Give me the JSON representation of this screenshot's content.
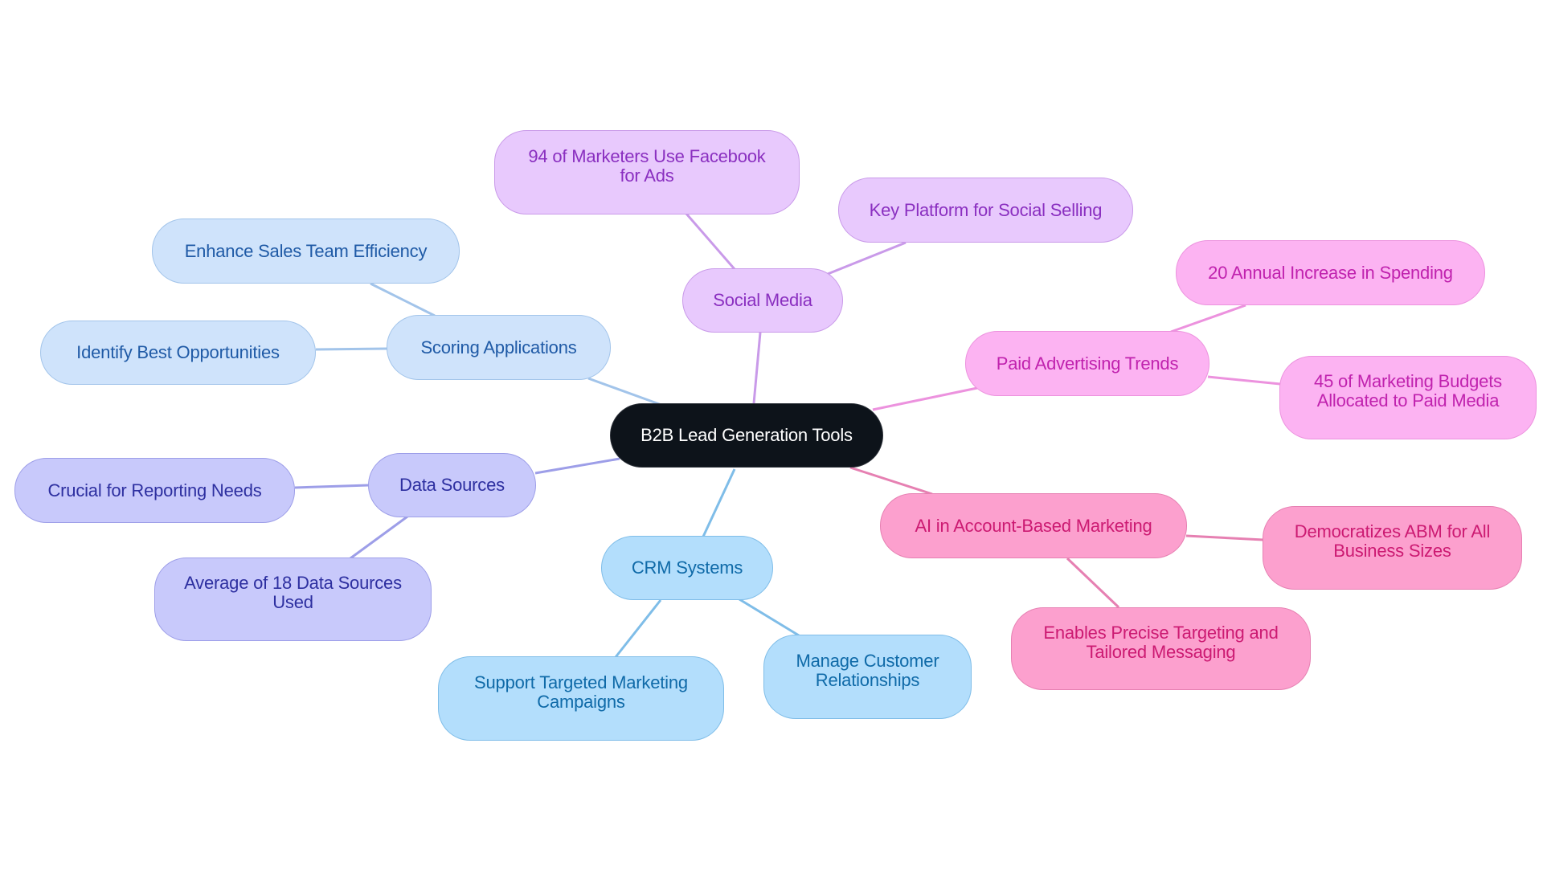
{
  "diagram": {
    "type": "mind-map",
    "root": {
      "id": "root",
      "label": "B2B Lead Generation Tools"
    },
    "branches": [
      {
        "id": "scoring",
        "label": "Scoring Applications",
        "color": "#a2c4ea",
        "children": [
          {
            "id": "scoring-1",
            "label": "Enhance Sales Team Efficiency"
          },
          {
            "id": "scoring-2",
            "label": "Identify Best Opportunities"
          }
        ]
      },
      {
        "id": "data",
        "label": "Data Sources",
        "color": "#9d9ee8",
        "children": [
          {
            "id": "data-1",
            "label": "Crucial for Reporting Needs"
          },
          {
            "id": "data-2",
            "label": "Average of 18 Data Sources Used"
          }
        ]
      },
      {
        "id": "crm",
        "label": "CRM Systems",
        "color": "#7fbde8",
        "children": [
          {
            "id": "crm-1",
            "label": "Support Targeted Marketing Campaigns"
          },
          {
            "id": "crm-2",
            "label": "Manage Customer Relationships"
          }
        ]
      },
      {
        "id": "social",
        "label": "Social Media",
        "color": "#c99ae9",
        "children": [
          {
            "id": "social-1",
            "label": "94 of Marketers Use Facebook for Ads"
          },
          {
            "id": "social-2",
            "label": "Key Platform for Social Selling"
          }
        ]
      },
      {
        "id": "paid",
        "label": "Paid Advertising Trends",
        "color": "#ec92de",
        "children": [
          {
            "id": "paid-1",
            "label": "20 Annual Increase in Spending"
          },
          {
            "id": "paid-2",
            "label": "45 of Marketing Budgets Allocated to Paid Media"
          }
        ]
      },
      {
        "id": "abm",
        "label": "AI in Account-Based Marketing",
        "color": "#e680b2",
        "children": [
          {
            "id": "abm-1",
            "label": "Democratizes ABM for All Business Sizes"
          },
          {
            "id": "abm-2",
            "label": "Enables Precise Targeting and Tailored Messaging"
          }
        ]
      }
    ]
  },
  "text": {
    "root": "B2B Lead Generation Tools",
    "scoring": "Scoring Applications",
    "scoring_1": "Enhance Sales Team Efficiency",
    "scoring_2": "Identify Best Opportunities",
    "data": "Data Sources",
    "data_1": "Crucial for Reporting Needs",
    "data_2a": "Average of 18 Data Sources",
    "data_2b": "Used",
    "crm": "CRM Systems",
    "crm_1a": "Support Targeted Marketing",
    "crm_1b": "Campaigns",
    "crm_2a": "Manage Customer",
    "crm_2b": "Relationships",
    "social": "Social Media",
    "social_1a": "94 of Marketers Use Facebook",
    "social_1b": "for Ads",
    "social_2": "Key Platform for Social Selling",
    "paid": "Paid Advertising Trends",
    "paid_1": "20 Annual Increase in Spending",
    "paid_2a": "45 of Marketing Budgets",
    "paid_2b": "Allocated to Paid Media",
    "abm": "AI in Account-Based Marketing",
    "abm_1a": "Democratizes ABM for All",
    "abm_1b": "Business Sizes",
    "abm_2a": "Enables Precise Targeting and",
    "abm_2b": "Tailored Messaging"
  }
}
